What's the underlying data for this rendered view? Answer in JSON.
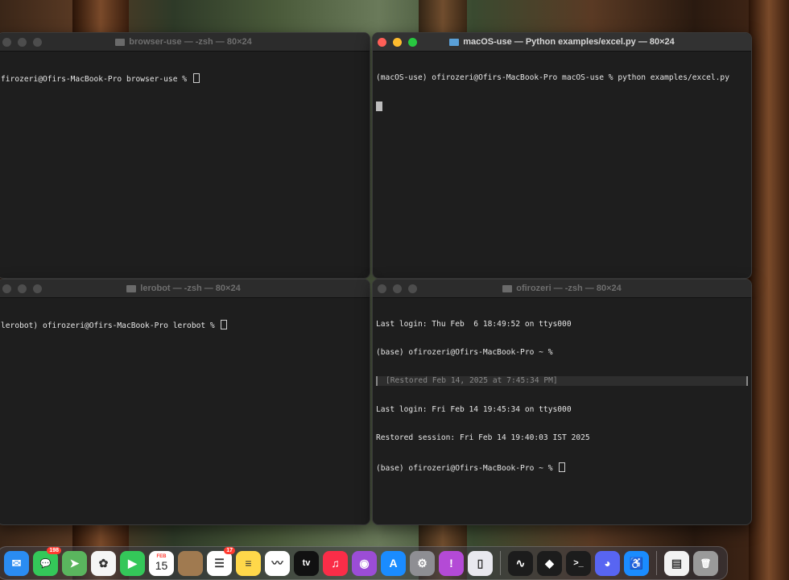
{
  "windows": {
    "top_left": {
      "title": "browser-use — -zsh — 80×24",
      "lines": [
        "firozeri@Ofirs-MacBook-Pro browser-use % "
      ]
    },
    "top_right": {
      "title": "macOS-use — Python examples/excel.py — 80×24",
      "lines": [
        "(macOS-use) ofirozeri@Ofirs-MacBook-Pro macOS-use % python examples/excel.py"
      ]
    },
    "bottom_left": {
      "title": "lerobot — -zsh — 80×24",
      "lines": [
        "lerobot) ofirozeri@Ofirs-MacBook-Pro lerobot % "
      ]
    },
    "bottom_right": {
      "title": "ofirozeri — -zsh — 80×24",
      "lines": [
        "Last login: Thu Feb  6 18:49:52 on ttys000",
        "(base) ofirozeri@Ofirs-MacBook-Pro ~ %",
        "[Restored Feb 14, 2025 at 7:45:34 PM]",
        "Last login: Fri Feb 14 19:45:34 on ttys000",
        "Restored session: Fri Feb 14 19:40:03 IST 2025",
        "(base) ofirozeri@Ofirs-MacBook-Pro ~ % "
      ]
    }
  },
  "dock": {
    "apps": [
      {
        "id": "mail",
        "icon": "mail-icon",
        "color": "#2a8cf2",
        "glyph": "✉"
      },
      {
        "id": "messages",
        "icon": "messages-icon",
        "color": "#34c759",
        "glyph": "💬",
        "badge": "198"
      },
      {
        "id": "maps",
        "icon": "maps-icon",
        "color": "#5ab55e",
        "glyph": "➤"
      },
      {
        "id": "photos",
        "icon": "photos-icon",
        "color": "#f5f5f5",
        "glyph": "✿"
      },
      {
        "id": "facetime",
        "icon": "facetime-icon",
        "color": "#34c759",
        "glyph": "▶"
      },
      {
        "id": "calendar",
        "icon": "calendar-icon",
        "color": "#ffffff",
        "glyph": "15",
        "month": "FEB"
      },
      {
        "id": "finder-bronze",
        "icon": "app-bronze-icon",
        "color": "#a07a50",
        "glyph": ""
      },
      {
        "id": "reminders",
        "icon": "reminders-icon",
        "color": "#ffffff",
        "glyph": "☰",
        "badge": "17"
      },
      {
        "id": "notes",
        "icon": "notes-icon",
        "color": "#ffd84a",
        "glyph": "≡"
      },
      {
        "id": "freeform",
        "icon": "freeform-icon",
        "color": "#ffffff",
        "glyph": "〰"
      },
      {
        "id": "tv",
        "icon": "tv-icon",
        "color": "#111111",
        "glyph": "tv"
      },
      {
        "id": "music",
        "icon": "music-icon",
        "color": "#fa2d48",
        "glyph": "♫"
      },
      {
        "id": "podcasts",
        "icon": "podcasts-icon",
        "color": "#9b4dd6",
        "glyph": "◉"
      },
      {
        "id": "appstore",
        "icon": "appstore-icon",
        "color": "#1a8cff",
        "glyph": "A"
      },
      {
        "id": "settings",
        "icon": "settings-icon",
        "color": "#8e8e93",
        "glyph": "⚙"
      },
      {
        "id": "feedback",
        "icon": "feedback-icon",
        "color": "#b44ad6",
        "glyph": "!"
      },
      {
        "id": "iphone-mirror",
        "icon": "iphone-mirroring-icon",
        "color": "#e8e8ee",
        "glyph": "▯"
      },
      {
        "sep": true
      },
      {
        "id": "activity",
        "icon": "activity-monitor-icon",
        "color": "#1c1c1c",
        "glyph": "∿"
      },
      {
        "id": "box",
        "icon": "cube-app-icon",
        "color": "#1c1c1c",
        "glyph": "◆"
      },
      {
        "id": "terminal",
        "icon": "terminal-icon",
        "color": "#1c1c1c",
        "glyph": ">_"
      },
      {
        "id": "discord",
        "icon": "discord-icon",
        "color": "#5865f2",
        "glyph": "◕"
      },
      {
        "id": "accessibility",
        "icon": "accessibility-inspector-icon",
        "color": "#1a8cff",
        "glyph": "♿"
      },
      {
        "sep": true
      },
      {
        "id": "pdf",
        "icon": "pdf-document-icon",
        "color": "#f2f2f2",
        "glyph": "▤"
      },
      {
        "id": "trash",
        "icon": "trash-icon",
        "color": "#9a9a9a",
        "glyph": "🗑"
      }
    ]
  }
}
